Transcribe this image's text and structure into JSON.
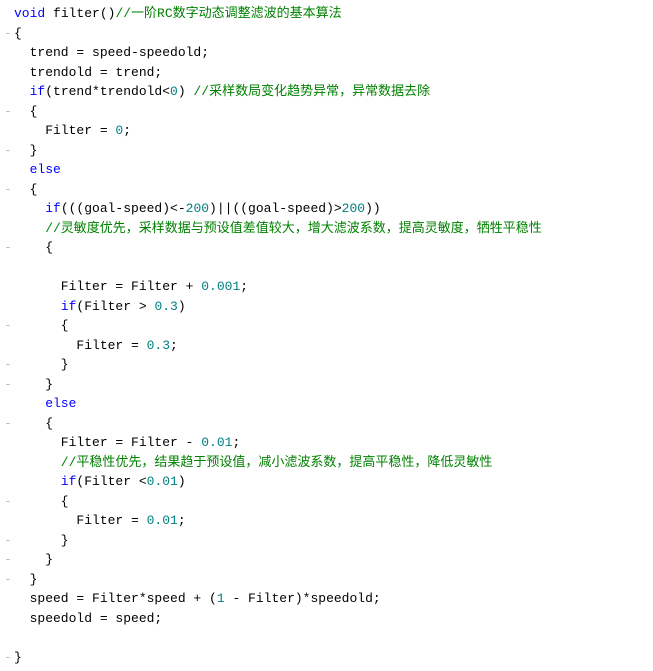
{
  "code": {
    "l1_kw": "void",
    "l1_fn": " filter()",
    "l1_cmt": "//一阶RC数字动态调整滤波的基本算法",
    "l2": "{",
    "l3": "  trend = speed-speedold;",
    "l4": "  trendold = trend;",
    "l5_kw": "  if",
    "l5a": "(trend*trendold<",
    "l5n": "0",
    "l5b": ") ",
    "l5_cmt": "//采样数局变化趋势异常，异常数据去除",
    "l6": "  {",
    "l7a": "    Filter = ",
    "l7n": "0",
    "l7b": ";",
    "l8": "  }",
    "l9_kw": "  else",
    "l10": "  {",
    "l11_kw": "    if",
    "l11a": "(((goal-speed)<-",
    "l11n1": "200",
    "l11b": ")||((goal-speed)>",
    "l11n2": "200",
    "l11c": "))",
    "l12_cmt": "    //灵敏度优先，采样数据与预设值差值较大，增大滤波系数，提高灵敏度，牺牲平稳性",
    "l13": "    {",
    "l14e": "",
    "l15a": "      Filter = Filter + ",
    "l15n": "0.001",
    "l15b": ";",
    "l16_kw": "      if",
    "l16a": "(Filter > ",
    "l16n": "0.3",
    "l16b": ")",
    "l17": "      {",
    "l18a": "        Filter = ",
    "l18n": "0.3",
    "l18b": ";",
    "l19": "      }",
    "l20": "    }",
    "l21_kw": "    else",
    "l22": "    {",
    "l23a": "      Filter = Filter - ",
    "l23n": "0.01",
    "l23b": ";",
    "l24_cmt": "      //平稳性优先，结果趋于预设值，减小滤波系数，提高平稳性，降低灵敏性",
    "l25_kw": "      if",
    "l25a": "(Filter <",
    "l25n": "0.01",
    "l25b": ")",
    "l26": "      {",
    "l27a": "        Filter = ",
    "l27n": "0.01",
    "l27b": ";",
    "l28": "      }",
    "l29": "    }",
    "l30": "  }",
    "l31a": "  speed = Filter*speed + (",
    "l31n": "1",
    "l31b": " - Filter)*speedold;",
    "l32": "  speedold = speed;",
    "l33e": "",
    "l34": "}"
  },
  "gut": {
    "dash": "-",
    "minus": "-",
    "blank": " "
  }
}
